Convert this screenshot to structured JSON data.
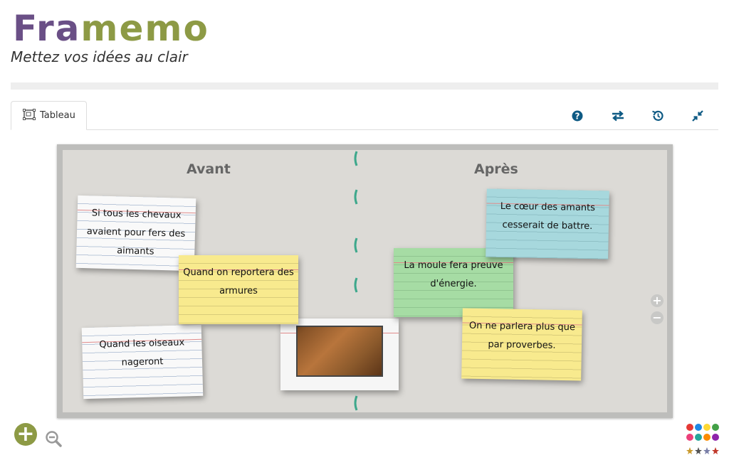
{
  "header": {
    "logo_part1": "Fra",
    "logo_part2": "memo",
    "tagline": "Mettez vos idées au clair"
  },
  "tabs": [
    {
      "label": "Tableau",
      "icon": "board-icon",
      "active": true
    }
  ],
  "toolbar": {
    "icons": [
      "help-icon",
      "swap-icon",
      "history-icon",
      "collapse-icon"
    ],
    "color": "#0e5a84"
  },
  "board": {
    "columns": [
      "Avant",
      "Après"
    ],
    "cards": [
      {
        "text": "Si tous les chevaux avaient pour fers des aimants",
        "color": "white"
      },
      {
        "text": "Quand on reportera des armures",
        "color": "yellow"
      },
      {
        "text": "Quand les oiseaux nageront",
        "color": "white"
      },
      {
        "text": "",
        "color": "white",
        "image": true
      },
      {
        "text": "La moule fera preuve d'énergie.",
        "color": "green"
      },
      {
        "text": "Le cœur des amants cesserait de battre.",
        "color": "blue"
      },
      {
        "text": "On ne parlera plus que par proverbes.",
        "color": "yellow"
      }
    ]
  },
  "side_zoom": {
    "in": "+",
    "out": "−"
  },
  "bottom": {
    "add_label": "+"
  },
  "palette_colors": [
    "#e53935",
    "#1e88e5",
    "#fdd835",
    "#43a047",
    "#ec407a",
    "#26a69a",
    "#fb8c00",
    "#8e24aa"
  ]
}
